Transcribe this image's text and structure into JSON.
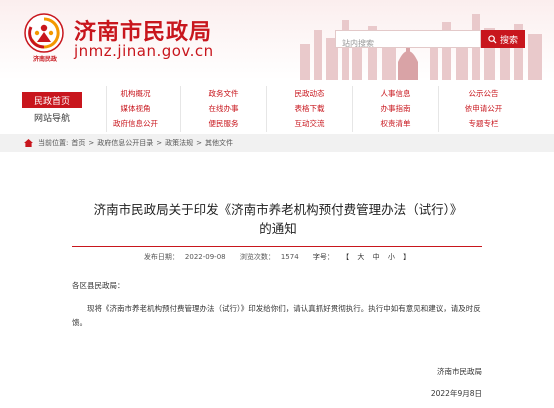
{
  "colors": {
    "brand": "#c8161d",
    "breadcrumb_bg": "#f1f1f1"
  },
  "header": {
    "logo_caption": "济南民政",
    "title": "济南市民政局",
    "domain": "jnmz.jinan.gov.cn",
    "search": {
      "placeholder": "站内搜索",
      "button_label": "搜索",
      "icon": "search-icon"
    }
  },
  "nav": {
    "home": "民政首页",
    "guide": "网站导航",
    "columns": [
      [
        "机构概况",
        "媒体视角",
        "政府信息公开"
      ],
      [
        "政务文件",
        "在线办事",
        "便民服务"
      ],
      [
        "民政动态",
        "表格下载",
        "互动交流"
      ],
      [
        "人事信息",
        "办事指南",
        "权责清单"
      ],
      [
        "公示公告",
        "依申请公开",
        "专题专栏"
      ]
    ]
  },
  "breadcrumb": {
    "icon": "home-icon",
    "label": "当前位置:",
    "items": [
      "首页",
      "政府信息公开目录",
      "政策法规",
      "其他文件"
    ],
    "separator": ">"
  },
  "article": {
    "title_line1": "济南市民政局关于印发《济南市养老机构预付费管理办法（试行）》",
    "title_line2": "的通知",
    "meta": {
      "date_label": "发布日期：",
      "date": "2022-09-08",
      "views_label": "浏览次数：",
      "views": "1574",
      "font_label": "字号：",
      "bracket_open": "【",
      "font_sizes": [
        "大",
        "中",
        "小"
      ],
      "bracket_close": "】"
    },
    "recipient": "各区县民政局：",
    "body": "现将《济南市养老机构预付费管理办法（试行）》印发给你们，请认真抓好贯彻执行。执行中如有意见和建议，请及时反馈。",
    "signature": "济南市民政局",
    "sign_date": "2022年9月8日"
  }
}
